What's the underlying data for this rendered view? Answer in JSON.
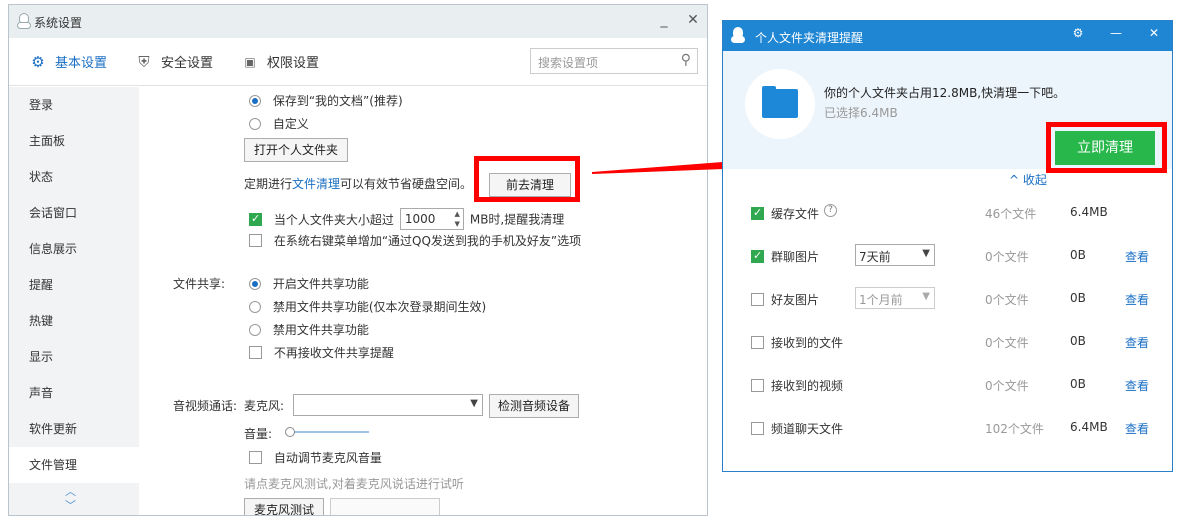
{
  "settings_window": {
    "title": "系统设置",
    "controls": {
      "minimize": "_",
      "close": "✕"
    },
    "tabs": [
      {
        "label": "基本设置",
        "icon": "gear-icon",
        "glyph": "⚙"
      },
      {
        "label": "安全设置",
        "icon": "shield-icon",
        "glyph": "⛨"
      },
      {
        "label": "权限设置",
        "icon": "lock-icon",
        "glyph": "🔒"
      }
    ],
    "search": {
      "placeholder": "搜索设置项",
      "icon": "search-icon"
    },
    "sidebar": {
      "items": [
        "登录",
        "主面板",
        "状态",
        "会话窗口",
        "信息展示",
        "提醒",
        "热键",
        "显示",
        "声音",
        "软件更新",
        "文件管理"
      ],
      "active": "文件管理",
      "scroll_up": "︿",
      "scroll_down": "﹀"
    },
    "file_management": {
      "save_option_1": "保存到“我的文档”(推荐)",
      "save_option_2": "自定义",
      "open_folder_button": "打开个人文件夹",
      "cleanup_text_prefix": "定期进行",
      "cleanup_link": "文件清理",
      "cleanup_text_suffix": "可以有效节省硬盘空间。",
      "go_cleanup_button": "前去清理",
      "size_limit_prefix": "当个人文件夹大小超过",
      "size_limit_value": "1000",
      "size_limit_suffix": "MB时,提醒我清理",
      "context_menu_option": "在系统右键菜单增加“通过QQ发送到我的手机及好友”选项"
    },
    "file_sharing": {
      "label": "文件共享:",
      "option_1": "开启文件共享功能",
      "option_2": "禁用文件共享功能(仅本次登录期间生效)",
      "option_3": "禁用文件共享功能",
      "no_reminder": "不再接收文件共享提醒"
    },
    "av_call": {
      "label": "音视频通话:",
      "mic_label": "麦克风:",
      "mic_value": "",
      "detect_button": "检测音频设备",
      "volume_label": "音量:",
      "auto_adjust": "自动调节麦克风音量",
      "hint": "请点麦克风测试,对着麦克风说话进行试听",
      "mic_test_button": "麦克风测试"
    }
  },
  "cleanup_window": {
    "title": "个人文件夹清理提醒",
    "controls": {
      "settings": "⚙",
      "minimize": "—",
      "close": "✕"
    },
    "message": "你的个人文件夹占用12.8MB,快清理一下吧。",
    "selected": "已选择6.4MB",
    "collapse_link": "^ 收起",
    "clean_now_button": "立即清理",
    "view_label": "查看",
    "rows": [
      {
        "name": "缓存文件",
        "checked": true,
        "help": "?",
        "period": "",
        "count": "46个文件",
        "size": "6.4MB",
        "has_view": false
      },
      {
        "name": "群聊图片",
        "checked": true,
        "help": "",
        "period": "7天前",
        "count": "0个文件",
        "size": "0B",
        "has_view": true
      },
      {
        "name": "好友图片",
        "checked": false,
        "help": "",
        "period": "1个月前",
        "count": "0个文件",
        "size": "0B",
        "has_view": true
      },
      {
        "name": "接收到的文件",
        "checked": false,
        "help": "",
        "period": "",
        "count": "0个文件",
        "size": "0B",
        "has_view": true
      },
      {
        "name": "接收到的视频",
        "checked": false,
        "help": "",
        "period": "",
        "count": "0个文件",
        "size": "0B",
        "has_view": true
      },
      {
        "name": "频道聊天文件",
        "checked": false,
        "help": "",
        "period": "",
        "count": "102个文件",
        "size": "6.4MB",
        "has_view": true
      }
    ]
  },
  "colors": {
    "accent_blue": "#1a6fc4",
    "title_blue": "#1f86d4",
    "green": "#27b74b",
    "highlight_red": "#ff0000"
  }
}
